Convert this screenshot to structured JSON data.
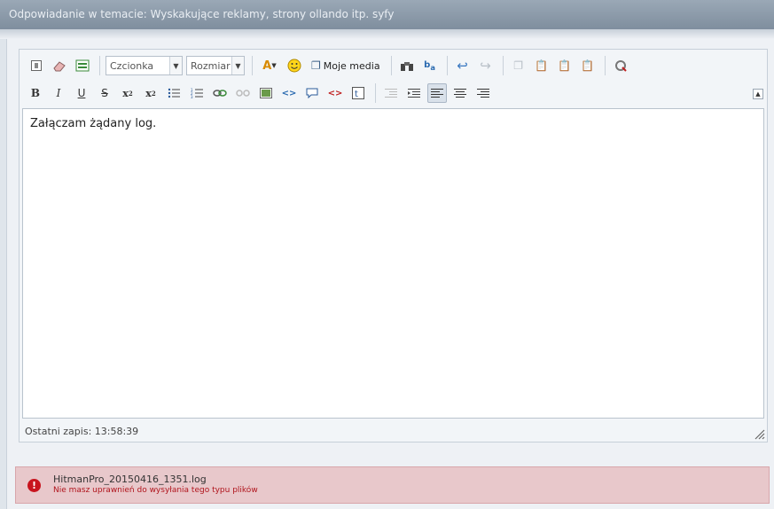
{
  "title": "Odpowiadanie w temacie: Wyskakujące reklamy, strony ollando itp. syfy",
  "toolbar": {
    "font_select": "Czcionka",
    "size_select": "Rozmiar",
    "media_label": "Moje media"
  },
  "editor": {
    "content": "Załączam żądany log.",
    "status": "Ostatni zapis: 13:58:39"
  },
  "error": {
    "filename": "HitmanPro_20150416_1351.log",
    "message": "Nie masz uprawnień do wysyłania tego typu plików"
  },
  "colors": {
    "title_bar": "#8c9aaa",
    "error_bg": "#e8c8cb",
    "error_text": "#b0141c",
    "error_icon": "#c8141e"
  }
}
